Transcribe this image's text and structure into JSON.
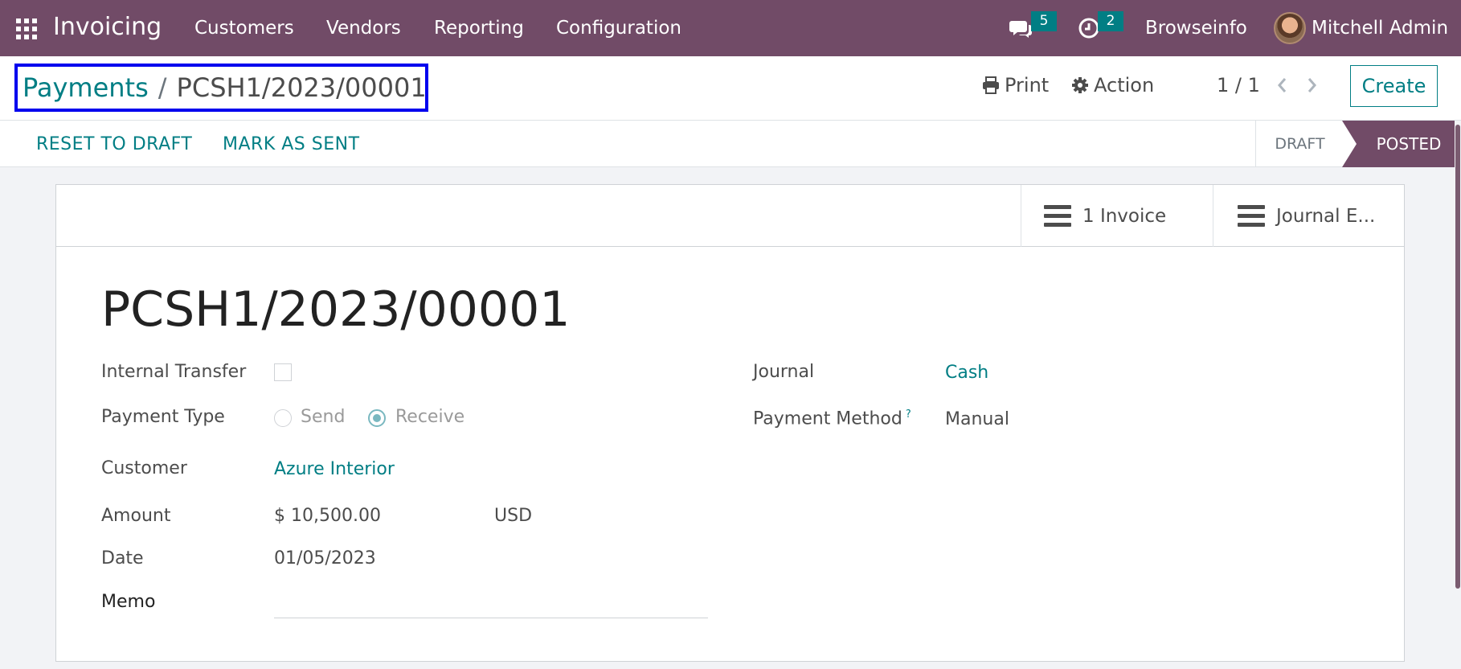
{
  "navbar": {
    "app_name": "Invoicing",
    "menu": [
      "Customers",
      "Vendors",
      "Reporting",
      "Configuration"
    ],
    "messages_count": "5",
    "activities_count": "2",
    "company": "Browseinfo",
    "user": "Mitchell Admin",
    "bg_color": "#714b67"
  },
  "breadcrumb": {
    "parent": "Payments",
    "separator": "/",
    "current": "PCSH1/2023/00001"
  },
  "control_panel": {
    "print_label": "Print",
    "action_label": "Action",
    "pager": "1 / 1",
    "create_label": "Create"
  },
  "statusbar": {
    "reset_label": "RESET TO DRAFT",
    "mark_sent_label": "MARK AS SENT",
    "stages": [
      "DRAFT",
      "POSTED"
    ],
    "active_stage": "POSTED"
  },
  "smart_buttons": {
    "invoice_label": "1 Invoice",
    "journal_label": "Journal E..."
  },
  "form": {
    "title": "PCSH1/2023/00001",
    "internal_transfer_label": "Internal Transfer",
    "internal_transfer_checked": false,
    "payment_type_label": "Payment Type",
    "payment_type_options": [
      "Send",
      "Receive"
    ],
    "payment_type_selected": "Receive",
    "customer_label": "Customer",
    "customer_value": "Azure Interior",
    "amount_label": "Amount",
    "amount_value": "$ 10,500.00",
    "currency_value": "USD",
    "date_label": "Date",
    "date_value": "01/05/2023",
    "memo_label": "Memo",
    "memo_value": "",
    "journal_label": "Journal",
    "journal_value": "Cash",
    "payment_method_label": "Payment Method",
    "payment_method_help": "?",
    "payment_method_value": "Manual"
  },
  "icons": {
    "apps": "grid-icon",
    "messages": "chat-icon",
    "activities": "clock-icon",
    "print": "printer-icon",
    "action": "gear-icon",
    "smart_button": "bars-icon"
  },
  "colors": {
    "accent": "#017e84",
    "brand": "#714b67",
    "selection_outline": "#0000ee"
  }
}
